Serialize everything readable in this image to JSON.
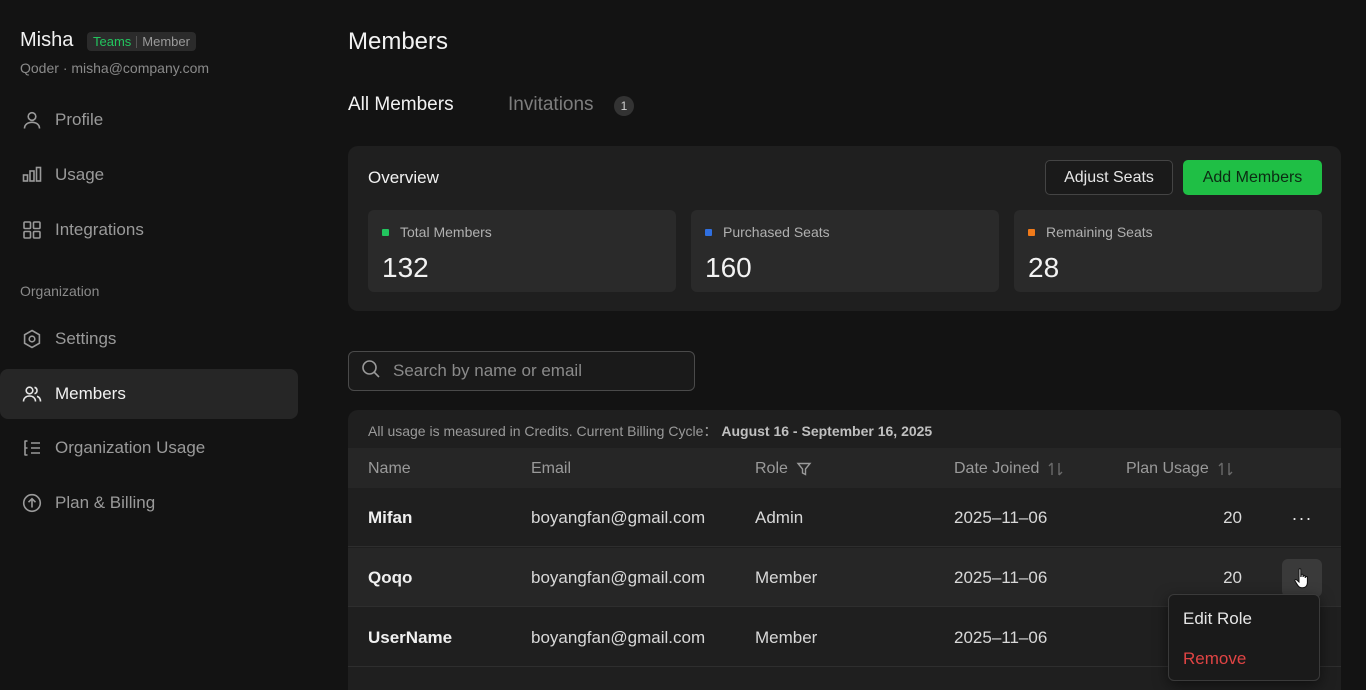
{
  "user": {
    "name": "Misha",
    "plan_badge": "Teams",
    "role_badge": "Member",
    "org": "Qoder",
    "separator": "·",
    "email": "misha@company.com"
  },
  "sidebar": {
    "items": [
      {
        "label": "Profile",
        "icon": "user-icon"
      },
      {
        "label": "Usage",
        "icon": "bar-chart-icon"
      },
      {
        "label": "Integrations",
        "icon": "grid-icon"
      }
    ],
    "org_section_label": "Organization",
    "org_items": [
      {
        "label": "Settings",
        "icon": "hexagon-settings-icon"
      },
      {
        "label": "Members",
        "icon": "users-icon",
        "active": true
      },
      {
        "label": "Organization Usage",
        "icon": "list-icon"
      },
      {
        "label": "Plan & Billing",
        "icon": "upgrade-arrow-icon"
      }
    ]
  },
  "main": {
    "title": "Members",
    "tabs": [
      {
        "label": "All Members",
        "active": true
      },
      {
        "label": "Invitations",
        "count": "1"
      }
    ],
    "overview": {
      "title": "Overview",
      "adjust_label": "Adjust Seats",
      "add_label": "Add Members",
      "stats": [
        {
          "label": "Total Members",
          "value": "132",
          "color": "#22c55e"
        },
        {
          "label": "Purchased Seats",
          "value": "160",
          "color": "#2f6fe0"
        },
        {
          "label": "Remaining Seats",
          "value": "28",
          "color": "#f07a1a"
        }
      ]
    },
    "search": {
      "placeholder": "Search by name or email",
      "value": ""
    },
    "table": {
      "note": "All usage is measured in Credits.  Current Billing Cycle：",
      "cycle": "August 16 - September 16, 2025",
      "columns": [
        "Name",
        "Email",
        "Role",
        "Date Joined",
        "Plan Usage"
      ],
      "rows": [
        {
          "name": "Mifan",
          "email": "boyangfan@gmail.com",
          "role": "Admin",
          "joined": "2025–11–06",
          "usage": "20"
        },
        {
          "name": "Qoqo",
          "email": "boyangfan@gmail.com",
          "role": "Member",
          "joined": "2025–11–06",
          "usage": "20"
        },
        {
          "name": "UserName",
          "email": "boyangfan@gmail.com",
          "role": "Member",
          "joined": "2025–11–06",
          "usage": ""
        }
      ],
      "more_glyph": "···"
    },
    "row_menu": {
      "edit_label": "Edit Role",
      "remove_label": "Remove"
    }
  },
  "colors": {
    "accent_green": "#1fbf45",
    "danger": "#e04444",
    "background": "#131313"
  }
}
